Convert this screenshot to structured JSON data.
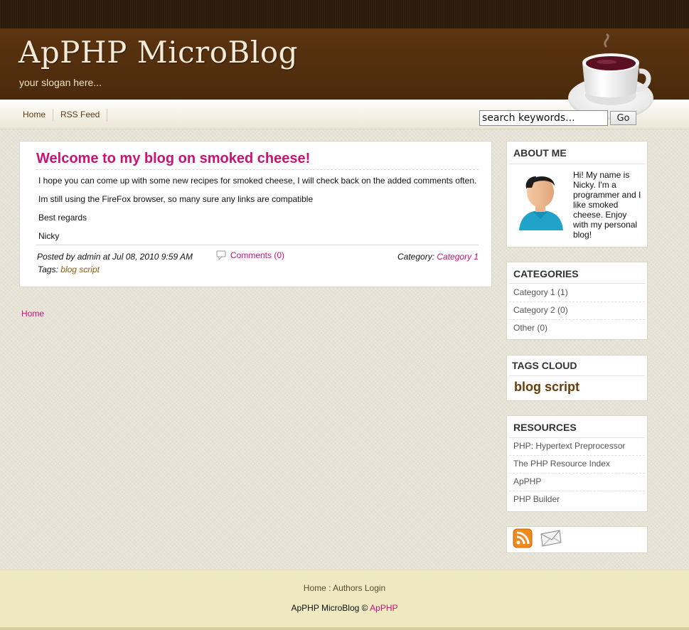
{
  "header": {
    "title": "ApPHP MicroBlog",
    "slogan": "your slogan here..."
  },
  "nav": {
    "items": [
      {
        "label": "Home"
      },
      {
        "label": "RSS Feed"
      }
    ]
  },
  "search": {
    "value": "search keywords...",
    "button_label": "Go"
  },
  "post": {
    "title": "Welcome to my blog on smoked cheese!",
    "paragraphs": [
      "I hope you can come up with some new recipes for smoked cheese, I will check back on the added comments often.",
      "Im still using the FireFox browser, so many sure any links are compatible",
      "Best regards",
      "Nicky"
    ],
    "posted_by": "Posted by admin at Jul 08, 2010 9:59 AM",
    "comments_label": "Comments (0)",
    "category_label": "Category:",
    "category_value": "Category 1",
    "tags_label": "Tags:",
    "tags_value": "blog script"
  },
  "breadcrumb": {
    "home": "Home"
  },
  "sidebar": {
    "about": {
      "title": "ABOUT ME",
      "text": "Hi! My name is Nicky. I'm a programmer and I like smoked cheese. Enjoy with my personal blog!"
    },
    "categories": {
      "title": "CATEGORIES",
      "items": [
        {
          "label": "Category 1 (1)"
        },
        {
          "label": "Category 2 (0)"
        },
        {
          "label": "Other (0)"
        }
      ]
    },
    "tags_cloud": {
      "title": "TAGS CLOUD",
      "tag": "blog script"
    },
    "resources": {
      "title": "RESOURCES",
      "items": [
        {
          "label": "PHP: Hypertext Preprocessor"
        },
        {
          "label": "The PHP Resource Index"
        },
        {
          "label": "ApPHP"
        },
        {
          "label": "PHP Builder"
        }
      ]
    },
    "icons": [
      "rss-icon",
      "mail-icon"
    ]
  },
  "footer": {
    "home_link": "Home",
    "separator": ":",
    "authors_login": "Authors Login",
    "copyright_prefix": "ApPHP MicroBlog ©",
    "copyright_link": "ApPHP"
  },
  "colors": {
    "accent": "#cc1177",
    "header_brown": "#4a2a0c",
    "footer_bg": "#efe9c1"
  }
}
